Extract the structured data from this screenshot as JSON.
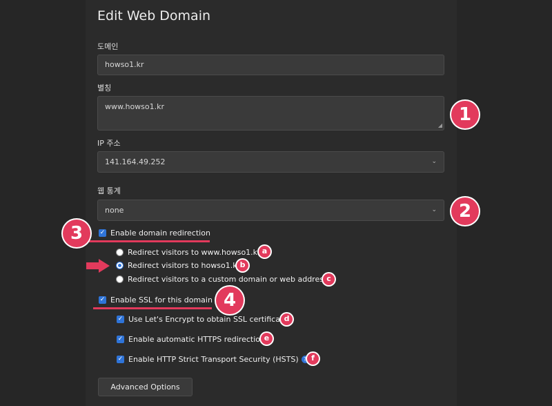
{
  "title": "Edit Web Domain",
  "domain": {
    "label": "도메인",
    "value": "howso1.kr"
  },
  "alias": {
    "label": "별칭",
    "value": "www.howso1.kr"
  },
  "ip": {
    "label": "IP 주소",
    "value": "141.164.49.252"
  },
  "stats": {
    "label": "웹 통계",
    "value": "none"
  },
  "redirect": {
    "label": "Enable domain redirection",
    "options": [
      "Redirect visitors to www.howso1.kr",
      "Redirect visitors to howso1.kr",
      "Redirect visitors to a custom domain or web address"
    ],
    "selected_index": 1
  },
  "ssl": {
    "label": "Enable SSL for this domain",
    "letsencrypt": "Use Let's Encrypt to obtain SSL certificate",
    "https_redirect": "Enable automatic HTTPS redirection",
    "hsts": "Enable HTTP Strict Transport Security (HSTS)"
  },
  "advanced_label": "Advanced Options",
  "badges": {
    "one": "1",
    "two": "2",
    "three": "3",
    "four": "4",
    "a": "a",
    "b": "b",
    "c": "c",
    "d": "d",
    "e": "e",
    "f": "f"
  },
  "accent_color": "#e23a5c",
  "checkbox_color": "#2f74d8",
  "icons": {
    "select": "chevron-down-icon",
    "help": "help-icon",
    "arrow": "arrow-right-icon"
  }
}
